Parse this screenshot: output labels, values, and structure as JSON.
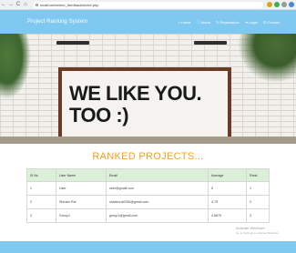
{
  "browser": {
    "url": "localhost/online_feedback/index.php",
    "back_glyph": "←",
    "forward_glyph": "→",
    "reload_glyph": "C",
    "home_glyph": "⌂",
    "colors": {
      "ext1": "#e3a21a",
      "ext2": "#3cae5a",
      "ext3": "#9a9a9a",
      "ext4": "#4a86d8"
    }
  },
  "header": {
    "brand": "Project Ranking System",
    "menu": [
      {
        "icon": "home-icon",
        "glyph": "⌂",
        "label": "Home"
      },
      {
        "icon": "info-icon",
        "glyph": "ⓘ",
        "label": "About"
      },
      {
        "icon": "registration-icon",
        "glyph": "✎",
        "label": "Registration"
      },
      {
        "icon": "login-icon",
        "glyph": "➜",
        "label": "Login"
      },
      {
        "icon": "contact-icon",
        "glyph": "✆",
        "label": "Contact"
      }
    ],
    "background": "#7fc8f0"
  },
  "hero": {
    "line1": "WE LIKE YOU.",
    "line2": "TOO :)"
  },
  "ranked": {
    "title": "RANKED PROJECTS...",
    "title_color": "#f0a020",
    "columns": [
      "Sl No",
      "User Name",
      "Email",
      "Average",
      "Rank"
    ],
    "rows": [
      [
        "1",
        "User",
        "user@gmail.com",
        "5",
        "1"
      ],
      [
        "2",
        "Shivam Rai",
        "shivamrai2256@gmail.com",
        "4.75",
        "2"
      ],
      [
        "3",
        "Group1",
        "group1@gmail.com",
        "4.6875",
        "3"
      ]
    ]
  },
  "watermark": {
    "title": "Activate Windows",
    "subtitle": "Go to Settings to activate Windows."
  }
}
